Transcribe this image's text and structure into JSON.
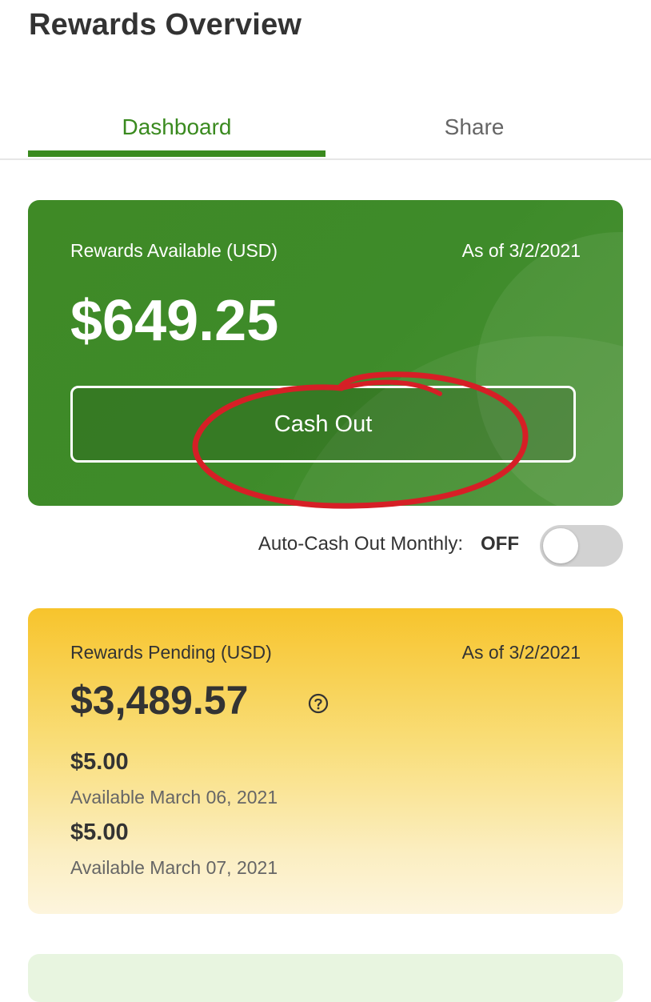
{
  "header": {
    "title": "Rewards Overview"
  },
  "tabs": [
    {
      "label": "Dashboard",
      "active": true
    },
    {
      "label": "Share",
      "active": false
    }
  ],
  "available_card": {
    "label": "Rewards Available (USD)",
    "as_of": "As of 3/2/2021",
    "amount": "$649.25",
    "cash_out_label": "Cash Out",
    "color": "#3e8b2a"
  },
  "auto_cash_out": {
    "label": "Auto-Cash Out Monthly:",
    "status": "OFF"
  },
  "pending_card": {
    "label": "Rewards Pending (USD)",
    "as_of": "As of 3/2/2021",
    "amount": "$3,489.57",
    "help_icon": "question-circle-icon",
    "items": [
      {
        "amount": "$5.00",
        "date": "Available March 06, 2021"
      },
      {
        "amount": "$5.00",
        "date": "Available March 07, 2021"
      }
    ],
    "color": "#f7c42c"
  },
  "annotation_color": "#d61f26",
  "accent_color": "#3a8a1f"
}
